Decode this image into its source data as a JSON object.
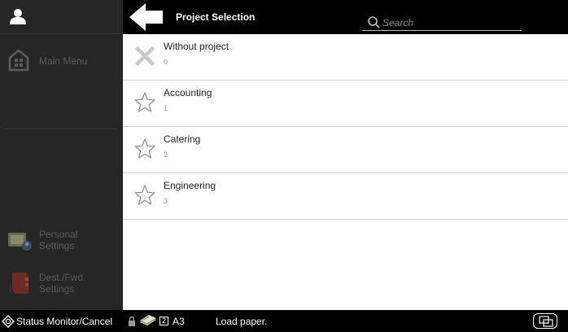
{
  "header": {
    "title": "Project Selection",
    "search_placeholder": "Search"
  },
  "sidebar": {
    "main_menu": "Main Menu",
    "personal_settings_line1": "Personal",
    "personal_settings_line2": "Settings",
    "dest_fwd_line1": "Dest./Fwd.",
    "dest_fwd_line2": "Settings"
  },
  "projects": [
    {
      "name": "Without project",
      "number": "0",
      "icon": "x-icon"
    },
    {
      "name": "Accounting",
      "number": "1",
      "icon": "star-icon"
    },
    {
      "name": "Catering",
      "number": "2",
      "icon": "star-icon"
    },
    {
      "name": "Engineering",
      "number": "3",
      "icon": "star-icon"
    }
  ],
  "statusbar": {
    "monitor_label": "Status Monitor/Cancel",
    "paper_count": "2",
    "paper_size": "A3",
    "message": "Load paper."
  },
  "colors": {
    "sidebar_bg": "#262626",
    "header_bg": "#000000",
    "list_bg": "#ffffff",
    "disabled_text": "#5d5d5d"
  }
}
